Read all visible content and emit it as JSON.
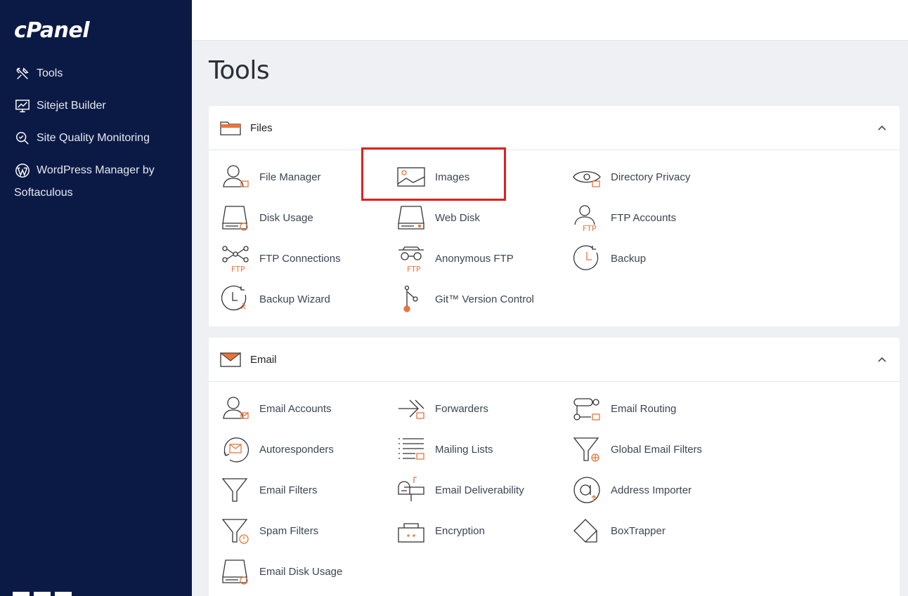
{
  "sidebar": {
    "logo": "cPanel",
    "items": [
      {
        "label": "Tools",
        "icon": "tools-icon"
      },
      {
        "label": "Sitejet Builder",
        "icon": "monitor-icon"
      },
      {
        "label": "Site Quality Monitoring",
        "icon": "magnifier-icon"
      },
      {
        "label": "WordPress Manager by",
        "label2": "Softaculous",
        "icon": "wordpress-icon"
      }
    ]
  },
  "page": {
    "title": "Tools"
  },
  "sections": {
    "files": {
      "title": "Files",
      "tools": [
        {
          "label": "File Manager",
          "icon": "file-manager-icon"
        },
        {
          "label": "Images",
          "icon": "images-icon"
        },
        {
          "label": "Directory Privacy",
          "icon": "directory-privacy-icon"
        },
        {
          "label": "Disk Usage",
          "icon": "disk-usage-icon"
        },
        {
          "label": "Web Disk",
          "icon": "web-disk-icon"
        },
        {
          "label": "FTP Accounts",
          "icon": "ftp-accounts-icon"
        },
        {
          "label": "FTP Connections",
          "icon": "ftp-connections-icon"
        },
        {
          "label": "Anonymous FTP",
          "icon": "anonymous-ftp-icon"
        },
        {
          "label": "Backup",
          "icon": "backup-icon"
        },
        {
          "label": "Backup Wizard",
          "icon": "backup-wizard-icon"
        },
        {
          "label": "Git™ Version Control",
          "icon": "git-icon"
        }
      ]
    },
    "email": {
      "title": "Email",
      "tools": [
        {
          "label": "Email Accounts",
          "icon": "email-accounts-icon"
        },
        {
          "label": "Forwarders",
          "icon": "forwarders-icon"
        },
        {
          "label": "Email Routing",
          "icon": "email-routing-icon"
        },
        {
          "label": "Autoresponders",
          "icon": "autoresponders-icon"
        },
        {
          "label": "Mailing Lists",
          "icon": "mailing-lists-icon"
        },
        {
          "label": "Global Email Filters",
          "icon": "global-email-filters-icon"
        },
        {
          "label": "Email Filters",
          "icon": "email-filters-icon"
        },
        {
          "label": "Email Deliverability",
          "icon": "email-deliverability-icon"
        },
        {
          "label": "Address Importer",
          "icon": "address-importer-icon"
        },
        {
          "label": "Spam Filters",
          "icon": "spam-filters-icon"
        },
        {
          "label": "Encryption",
          "icon": "encryption-icon"
        },
        {
          "label": "BoxTrapper",
          "icon": "boxtrapper-icon"
        },
        {
          "label": "Email Disk Usage",
          "icon": "email-disk-usage-icon"
        }
      ]
    }
  },
  "colors": {
    "sidebar_bg": "#0b1a45",
    "accent": "#e8743b",
    "highlight": "#e0201f"
  }
}
